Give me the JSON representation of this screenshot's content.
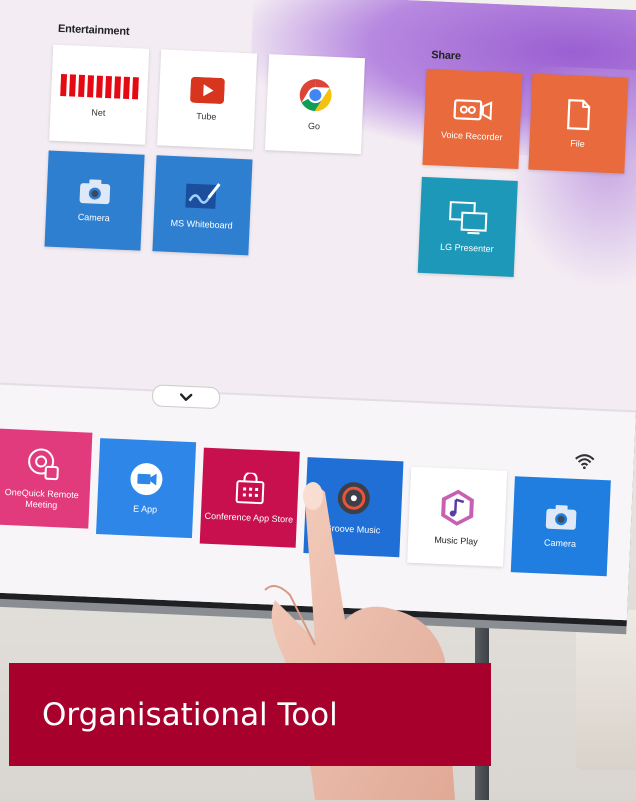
{
  "sections": {
    "entertainment": "Entertainment",
    "share": "Share"
  },
  "entertainment_tiles": [
    {
      "label": "Net",
      "icon": "netflix-icon"
    },
    {
      "label": "Tube",
      "icon": "youtube-icon"
    },
    {
      "label": "Go",
      "icon": "chrome-icon"
    },
    {
      "label": "Camera",
      "icon": "camera-icon"
    },
    {
      "label": "MS Whiteboard",
      "icon": "whiteboard-icon"
    }
  ],
  "share_tiles": [
    {
      "label": "Voice Recorder",
      "icon": "voice-recorder-icon"
    },
    {
      "label": "File",
      "icon": "file-icon"
    },
    {
      "label": "LG Presenter",
      "icon": "presenter-icon"
    }
  ],
  "dock": [
    {
      "label": "OneQuick Remote Meeting",
      "color": "#e23b7d",
      "icon": "remote-meeting-icon"
    },
    {
      "label": "E App",
      "color": "#2e86e8",
      "icon": "video-call-icon"
    },
    {
      "label": "Conference App Store",
      "color": "#c8104f",
      "icon": "app-store-icon"
    },
    {
      "label": "Groove Music",
      "color": "#1f6fd6",
      "icon": "groove-music-icon"
    },
    {
      "label": "Music Play",
      "color": "#ffffff",
      "icon": "music-play-icon"
    },
    {
      "label": "Camera",
      "color": "#1f7ee0",
      "icon": "camera-icon"
    }
  ],
  "banner": {
    "text": "Organisational Tool",
    "color": "#a8002d"
  }
}
